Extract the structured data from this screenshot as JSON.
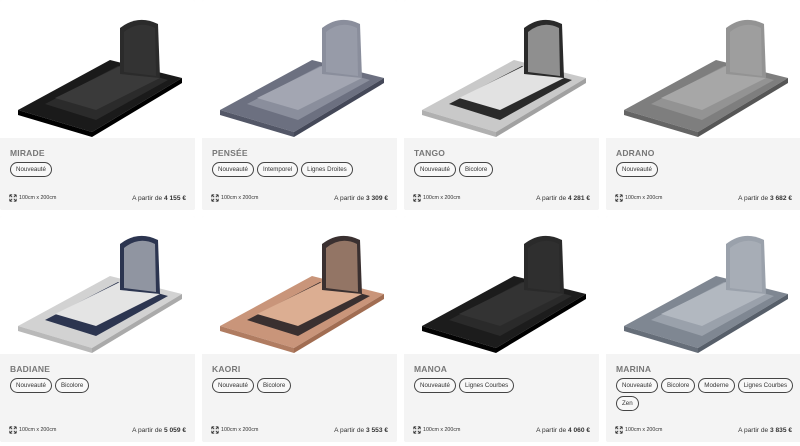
{
  "products": [
    {
      "name": "MIRADE",
      "tags": [
        "Nouveauté"
      ],
      "dims": "100cm x 200cm",
      "price_prefix": "A partir de",
      "price": "4 155 €",
      "stone": "#1a1a1a",
      "accent": "#2b2b2b",
      "top": "#3a3a3a",
      "icon": "tombstone-image"
    },
    {
      "name": "PENSÉE",
      "tags": [
        "Nouveauté",
        "Intemporel",
        "Lignes Droites"
      ],
      "dims": "100cm x 200cm",
      "price_prefix": "A partir de",
      "price": "3 309 €",
      "stone": "#6c7080",
      "accent": "#8a8e9c",
      "top": "#a3a6b2",
      "icon": "tombstone-image"
    },
    {
      "name": "TANGO",
      "tags": [
        "Nouveauté",
        "Bicolore"
      ],
      "dims": "100cm x 200cm",
      "price_prefix": "A partir de",
      "price": "4 281 €",
      "stone": "#c9c9c9",
      "accent": "#2a2a2a",
      "top": "#e2e2e2",
      "icon": "tombstone-image"
    },
    {
      "name": "ADRANO",
      "tags": [
        "Nouveauté"
      ],
      "dims": "100cm x 200cm",
      "price_prefix": "A partir de",
      "price": "3 682 €",
      "stone": "#7e7e7e",
      "accent": "#939393",
      "top": "#a7a7a7",
      "icon": "tombstone-image"
    },
    {
      "name": "BADIANE",
      "tags": [
        "Nouveauté",
        "Bicolore"
      ],
      "dims": "100cm x 200cm",
      "price_prefix": "A partir de",
      "price": "5 059 €",
      "stone": "#d2d2d2",
      "accent": "#2c3550",
      "top": "#e4e4e4",
      "icon": "tombstone-image"
    },
    {
      "name": "KAORI",
      "tags": [
        "Nouveauté",
        "Bicolore"
      ],
      "dims": "100cm x 200cm",
      "price_prefix": "A partir de",
      "price": "3 553 €",
      "stone": "#c9957a",
      "accent": "#3a3030",
      "top": "#dcae92",
      "icon": "tombstone-image"
    },
    {
      "name": "MANOA",
      "tags": [
        "Nouveauté",
        "Lignes Courbes"
      ],
      "dims": "100cm x 200cm",
      "price_prefix": "A partir de",
      "price": "4 060 €",
      "stone": "#1c1c1c",
      "accent": "#2a2a2a",
      "top": "#333333",
      "icon": "tombstone-image"
    },
    {
      "name": "MARINA",
      "tags": [
        "Nouveauté",
        "Bicolore",
        "Moderne",
        "Lignes Courbes",
        "Zen"
      ],
      "dims": "100cm x 200cm",
      "price_prefix": "A partir de",
      "price": "3 835 €",
      "stone": "#7f8792",
      "accent": "#9aa1ab",
      "top": "#b2b8c0",
      "icon": "tombstone-image"
    }
  ]
}
